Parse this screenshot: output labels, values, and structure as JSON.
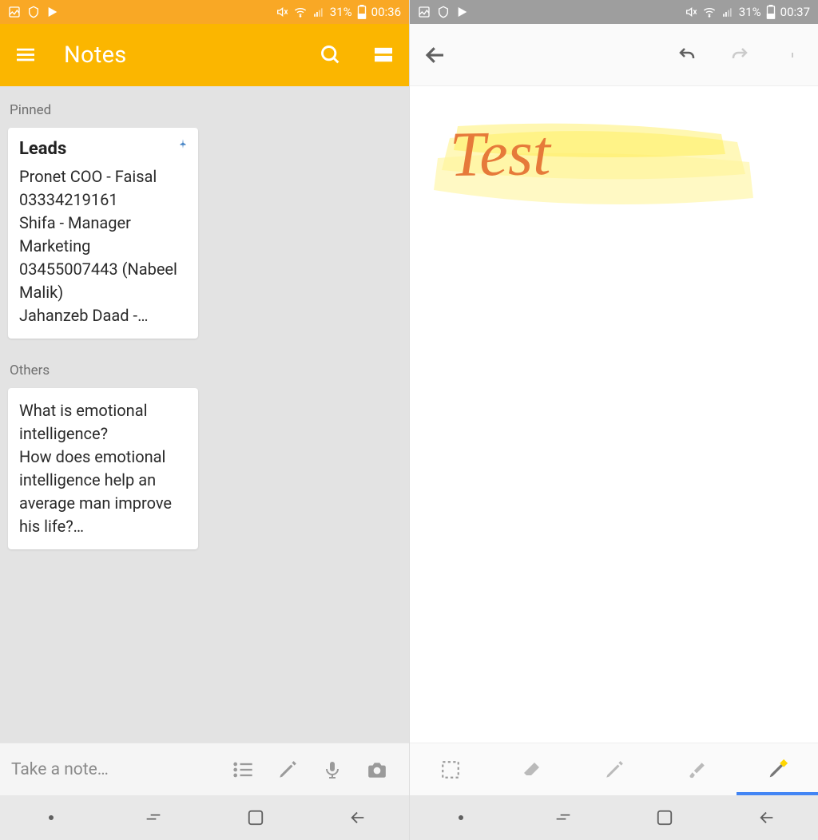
{
  "left": {
    "status": {
      "battery": "31%",
      "time": "00:36"
    },
    "appbar": {
      "title": "Notes"
    },
    "sections": {
      "pinned_label": "Pinned",
      "others_label": "Others"
    },
    "pinned_note": {
      "title": "Leads",
      "body": "Pronet COO - Faisal 03334219161\nShifa - Manager Marketing 03455007443 (Nabeel Malik)\nJahanzeb Daad -…"
    },
    "other_note": {
      "body": "What is emotional intelligence?\nHow does emotional intelligence help an average man improve his life?…"
    },
    "bottom": {
      "placeholder": "Take a note…"
    }
  },
  "right": {
    "status": {
      "battery": "31%",
      "time": "00:37"
    },
    "drawing": {
      "text": "Test"
    }
  }
}
